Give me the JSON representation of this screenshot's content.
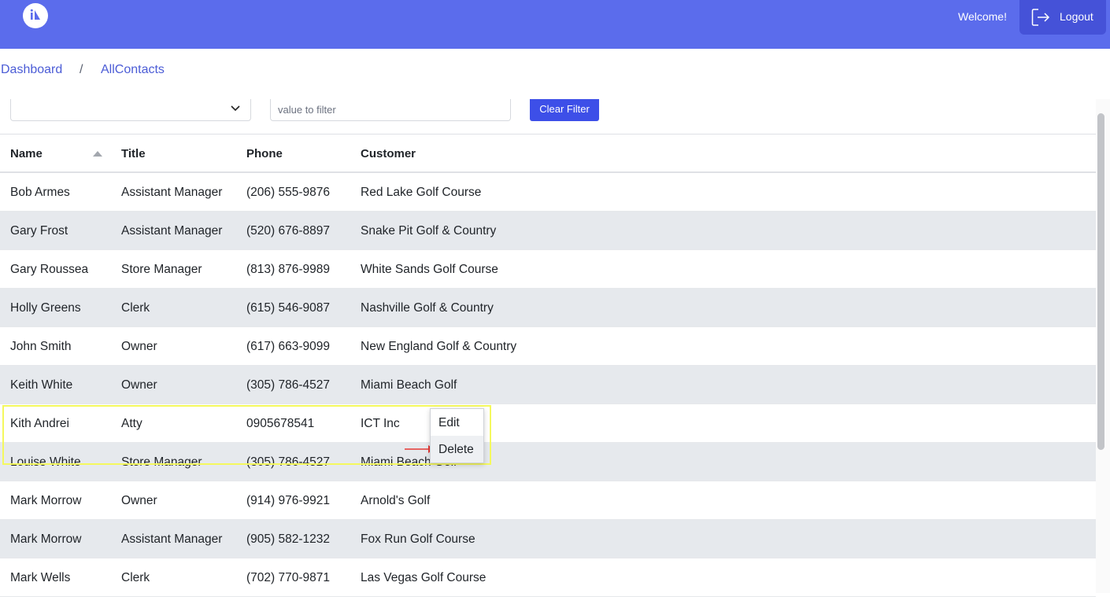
{
  "header": {
    "welcome_text": "Welcome!",
    "logout_label": "Logout",
    "brand_color": "#5b6cec"
  },
  "breadcrumb": {
    "items": [
      "Dashboard",
      "AllContacts"
    ],
    "separator": "/"
  },
  "filter": {
    "select_value": "",
    "input_placeholder": "value to filter",
    "clear_label": "Clear Filter"
  },
  "table": {
    "columns": [
      "Name",
      "Title",
      "Phone",
      "Customer"
    ],
    "sorted_column": "Name",
    "rows": [
      {
        "name": "Bob Armes",
        "title": "Assistant Manager",
        "phone": "(206) 555-9876",
        "customer": "Red Lake Golf Course"
      },
      {
        "name": "Gary Frost",
        "title": "Assistant Manager",
        "phone": "(520) 676-8897",
        "customer": "Snake Pit Golf & Country"
      },
      {
        "name": "Gary Roussea",
        "title": "Store Manager",
        "phone": "(813) 876-9989",
        "customer": "White Sands Golf Course"
      },
      {
        "name": "Holly Greens",
        "title": "Clerk",
        "phone": "(615) 546-9087",
        "customer": "Nashville Golf & Country"
      },
      {
        "name": "John Smith",
        "title": "Owner",
        "phone": "(617) 663-9099",
        "customer": "New England Golf & Country"
      },
      {
        "name": "Keith White",
        "title": "Owner",
        "phone": "(305) 786-4527",
        "customer": "Miami Beach Golf"
      },
      {
        "name": "Kith Andrei",
        "title": "Atty",
        "phone": "0905678541",
        "customer": "ICT Inc"
      },
      {
        "name": "Louise White",
        "title": "Store Manager",
        "phone": "(305) 786-4527",
        "customer": "Miami Beach Golf"
      },
      {
        "name": "Mark Morrow",
        "title": "Owner",
        "phone": "(914) 976-9921",
        "customer": "Arnold's Golf"
      },
      {
        "name": "Mark Morrow",
        "title": "Assistant Manager",
        "phone": "(905) 582-1232",
        "customer": "Fox Run Golf Course"
      },
      {
        "name": "Mark Wells",
        "title": "Clerk",
        "phone": "(702) 770-9871",
        "customer": "Las Vegas Golf Course"
      }
    ]
  },
  "context_menu": {
    "edit_label": "Edit",
    "delete_label": "Delete"
  },
  "colors": {
    "highlight_border": "#f4f85e",
    "arrow": "#e53935",
    "primary_button": "#3d4fe8"
  }
}
